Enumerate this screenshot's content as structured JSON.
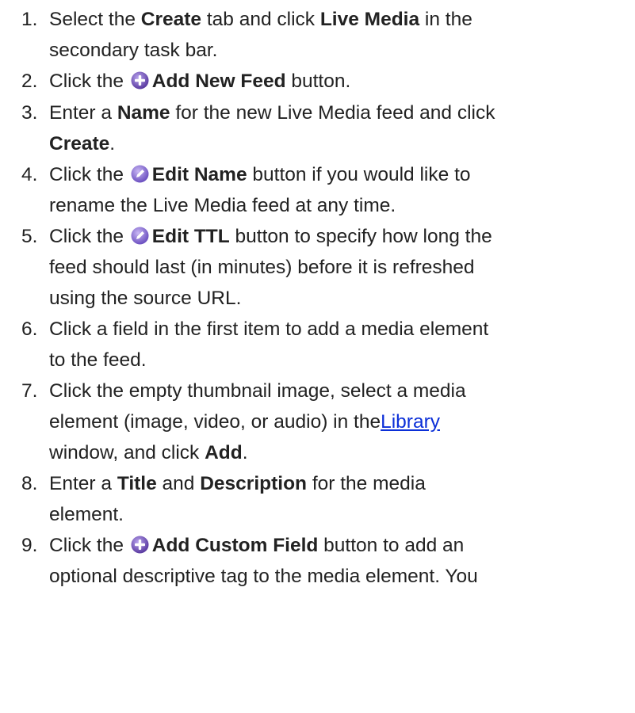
{
  "steps": [
    {
      "number": "1.",
      "lines": [
        [
          "Select the ",
          "Create",
          " tab and click ",
          "Live Media",
          " in the"
        ],
        [
          "secondary task bar."
        ]
      ]
    },
    {
      "number": "2.",
      "lines": [
        [
          "Click the ",
          "Add New Feed",
          " button."
        ]
      ],
      "icon": "add-circle-icon"
    },
    {
      "number": "3.",
      "lines": [
        [
          "Enter a ",
          "Name",
          " for the new Live Media feed and click"
        ],
        [
          "Create",
          "."
        ]
      ]
    },
    {
      "number": "4.",
      "lines": [
        [
          "Click the ",
          "Edit Name",
          " button if you would like to"
        ],
        [
          "rename the Live Media feed at any time."
        ]
      ],
      "icon": "edit-pencil-icon"
    },
    {
      "number": "5.",
      "lines": [
        [
          "Click the ",
          "Edit TTL",
          " button to specify how long the"
        ],
        [
          "feed should last (in minutes) before it is refreshed"
        ],
        [
          "using the source URL."
        ]
      ],
      "icon": "edit-pencil-icon"
    },
    {
      "number": "6.",
      "lines": [
        [
          "Click a field in the first item to add a media element"
        ],
        [
          "to the feed."
        ]
      ]
    },
    {
      "number": "7.",
      "lines": [
        [
          "Click the empty thumbnail image, select a media"
        ],
        [
          "element (image, video, or audio) in the",
          "Library"
        ],
        [
          "window, and click ",
          "Add",
          "."
        ]
      ]
    },
    {
      "number": "8.",
      "lines": [
        [
          "Enter a ",
          "Title",
          " and ",
          "Description",
          " for the media"
        ],
        [
          "element."
        ]
      ]
    },
    {
      "number": "9.",
      "lines": [
        [
          "Click the ",
          "Add Custom Field",
          " button to add an"
        ],
        [
          "optional descriptive tag to the media element. You"
        ]
      ],
      "icon": "add-circle-icon"
    }
  ],
  "colors": {
    "text": "#222222",
    "link": "#0b2fd8",
    "add_icon": "#6a4bb3",
    "edit_icon": "#8a6fd6"
  }
}
